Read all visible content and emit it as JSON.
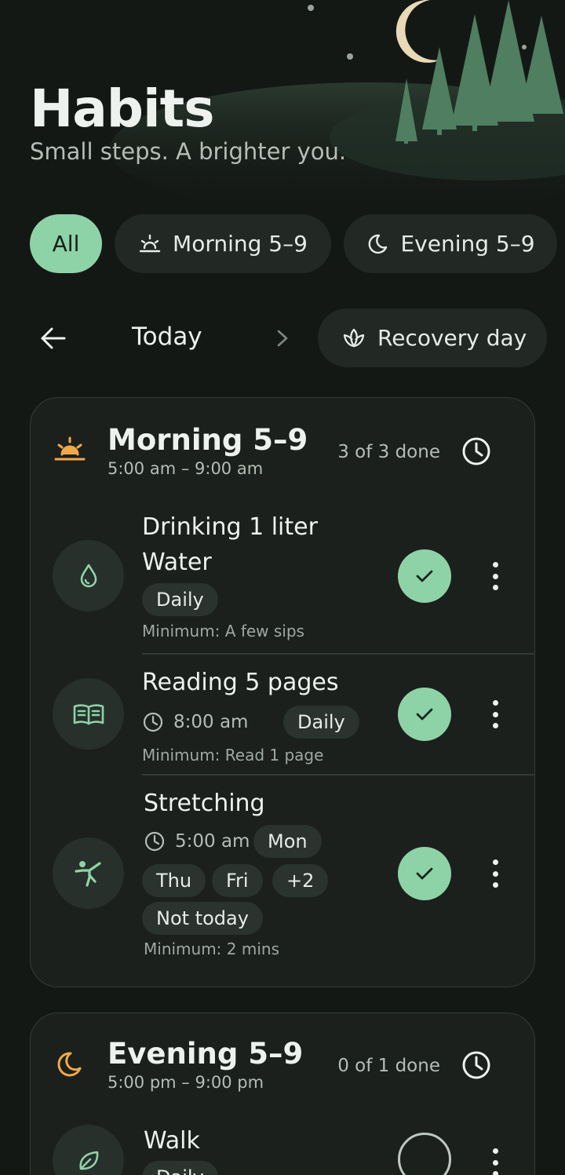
{
  "header": {
    "title": "Habits",
    "subtitle": "Small steps. A brighter you."
  },
  "filters": [
    {
      "label": "All",
      "active": true,
      "icon": "none"
    },
    {
      "label": "Morning 5–9",
      "active": false,
      "icon": "sunrise-icon"
    },
    {
      "label": "Evening 5–9",
      "active": false,
      "icon": "moon-icon"
    }
  ],
  "nav": {
    "label": "Today",
    "recovery_label": "Recovery day"
  },
  "sections": [
    {
      "title": "Morning 5–9",
      "time": "5:00 am – 9:00 am",
      "count": "3 of 3 done",
      "habits": [
        {
          "name_line1": "Drinking 1 liter",
          "name_line2": "Water",
          "tags": [
            "Daily"
          ],
          "minimum": "Minimum: A few sips",
          "done": true,
          "icon": "water-drop-icon"
        },
        {
          "name_line1": "Reading 5 pages",
          "time": "8:00 am",
          "tags": [
            "Daily"
          ],
          "minimum": "Minimum: Read 1 page",
          "done": true,
          "icon": "book-icon"
        },
        {
          "name_line1": "Stretching",
          "time": "5:00 am",
          "tags": [
            "Mon",
            "Thu",
            "Fri",
            "+2",
            "Not today"
          ],
          "minimum": "Minimum: 2 mins",
          "done": true,
          "icon": "stretch-figure-icon"
        }
      ]
    },
    {
      "title": "Evening 5–9",
      "time": "5:00 pm – 9:00 pm",
      "count": "0 of 1 done",
      "habits": [
        {
          "name_line1": "Walk",
          "tags": [
            "Daily"
          ],
          "done": false,
          "icon": "leaf-icon"
        }
      ]
    }
  ],
  "colors": {
    "background": "#141815",
    "accent": "#8ED3A7",
    "section_icon": "#F0A948",
    "moon": "#E9D9B5",
    "trees": "#4F7E60"
  }
}
